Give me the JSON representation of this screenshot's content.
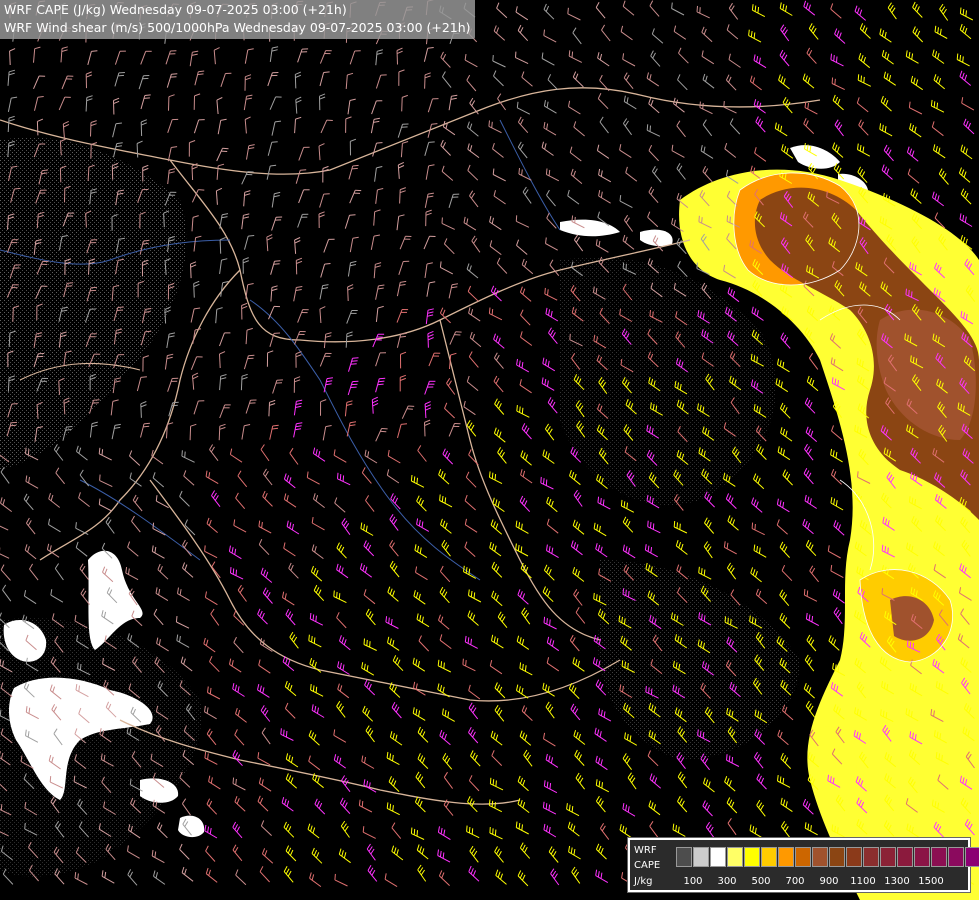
{
  "title": {
    "line1": "WRF CAPE (J/kg) Wednesday 09-07-2025 03:00 (+21h)",
    "line2": "WRF Wind shear (m/s) 500/1000hPa Wednesday 09-07-2025 03:00 (+21h)"
  },
  "legend": {
    "label_line1": "WRF",
    "label_line2": "CAPE",
    "label_line3": "J/kg",
    "colors": [
      "#4d4d4d",
      "#cccccc",
      "#ffffff",
      "#ffff66",
      "#ffff00",
      "#ffcc00",
      "#ff9900",
      "#cc6600",
      "#a0522d",
      "#8b4513",
      "#8b3a1a",
      "#8b2e2e",
      "#8b2236",
      "#8b1a3d",
      "#8b1446",
      "#8b0f52",
      "#8b0a5e",
      "#8b0073"
    ],
    "tick_labels": [
      "100",
      "300",
      "500",
      "700",
      "900",
      "1100",
      "1300",
      "1500"
    ]
  }
}
